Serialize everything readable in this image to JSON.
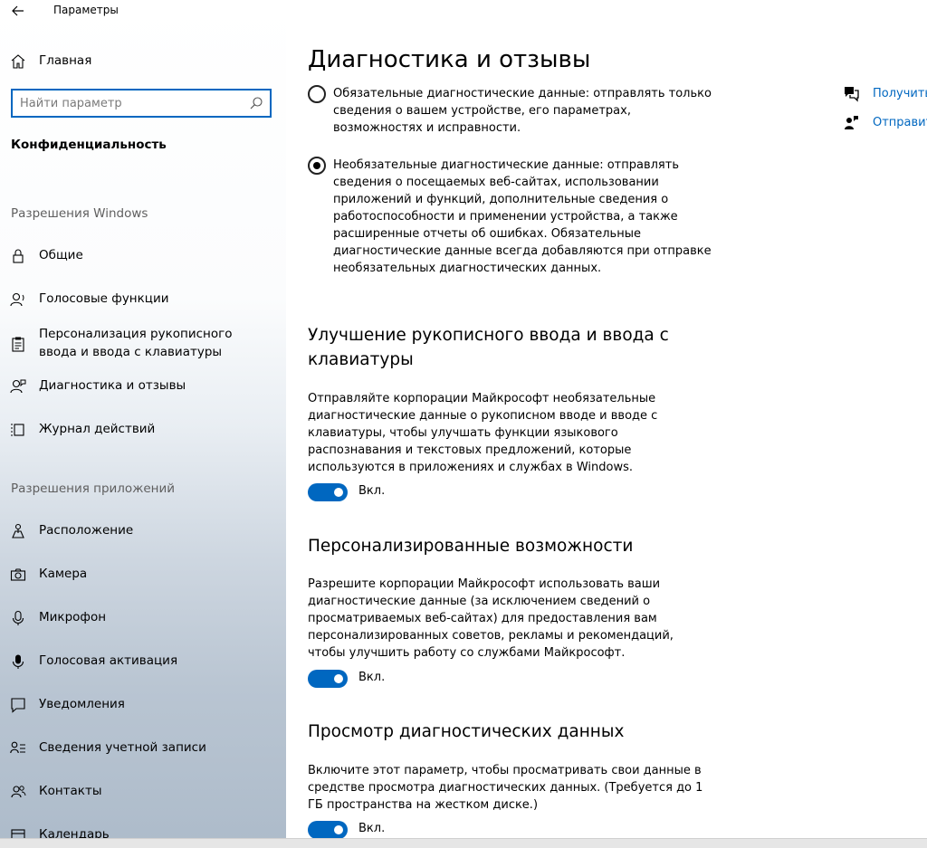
{
  "window": {
    "title": "Параметры"
  },
  "sidebar": {
    "home_label": "Главная",
    "search_placeholder": "Найти параметр",
    "category": "Конфиденциальность",
    "groups": [
      {
        "header": "Разрешения Windows"
      },
      {
        "header": "Разрешения приложений"
      }
    ],
    "windows_items": [
      {
        "label": "Общие",
        "icon": "lock-icon"
      },
      {
        "label": "Голосовые функции",
        "icon": "speech-icon"
      },
      {
        "label": "Персонализация рукописного ввода и ввода с клавиатуры",
        "icon": "clipboard-icon"
      },
      {
        "label": "Диагностика и отзывы",
        "icon": "feedback-person-icon"
      },
      {
        "label": "Журнал действий",
        "icon": "timeline-icon"
      }
    ],
    "app_items": [
      {
        "label": "Расположение",
        "icon": "location-icon"
      },
      {
        "label": "Камера",
        "icon": "camera-icon"
      },
      {
        "label": "Микрофон",
        "icon": "microphone-icon"
      },
      {
        "label": "Голосовая активация",
        "icon": "microphone-filled-icon"
      },
      {
        "label": "Уведомления",
        "icon": "notification-icon"
      },
      {
        "label": "Сведения учетной записи",
        "icon": "account-info-icon"
      },
      {
        "label": "Контакты",
        "icon": "contacts-icon"
      },
      {
        "label": "Календарь",
        "icon": "calendar-icon"
      }
    ]
  },
  "main": {
    "title": "Диагностика и отзывы",
    "options": [
      {
        "text": "Обязательные диагностические данные: отправлять только сведения о вашем устройстве, его параметрах, возможностях и исправности.",
        "checked": false
      },
      {
        "text": "Необязательные диагностические данные: отправлять сведения о посещаемых веб-сайтах, использовании приложений и функций, дополнительные сведения о работоспособности и применении устройства, а также расширенные отчеты об ошибках. Обязательные диагностические данные всегда добавляются при отправке необязательных диагностических данных.",
        "checked": true
      }
    ],
    "sections": [
      {
        "title": "Улучшение рукописного ввода и ввода с клавиатуры",
        "description": "Отправляйте корпорации Майкрософт необязательные диагностические данные о рукописном вводе и вводе с клавиатуры, чтобы улучшать функции языкового распознавания и текстовых предложений, которые используются в приложениях и службах в Windows.",
        "toggle_label": "Вкл.",
        "toggle_on": true
      },
      {
        "title": "Персонализированные возможности",
        "description": "Разрешите корпорации Майкрософт использовать ваши диагностические данные (за исключением сведений о просматриваемых веб-сайтах) для предоставления вам персонализированных советов, рекламы и рекомендаций, чтобы улучшить работу со службами Майкрософт.",
        "toggle_label": "Вкл.",
        "toggle_on": true
      },
      {
        "title": "Просмотр диагностических данных",
        "description": "Включите этот параметр, чтобы просматривать свои данные в средстве просмотра диагностических данных. (Требуется до 1 ГБ пространства на жестком диске.)",
        "toggle_label": "Вкл.",
        "toggle_on": true
      }
    ]
  },
  "related": [
    {
      "label": "Получить",
      "icon": "help-chat-icon"
    },
    {
      "label": "Отправит",
      "icon": "feedback-icon"
    }
  ],
  "colors": {
    "accent": "#0067c0",
    "group_header": "#5f5f5f"
  }
}
